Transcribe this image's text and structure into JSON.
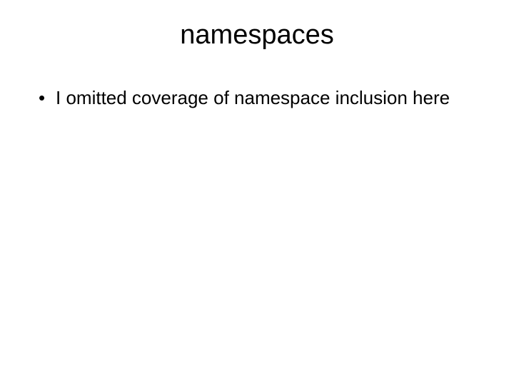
{
  "slide": {
    "title": "namespaces",
    "bullets": [
      "I omitted coverage of namespace inclusion here"
    ]
  }
}
